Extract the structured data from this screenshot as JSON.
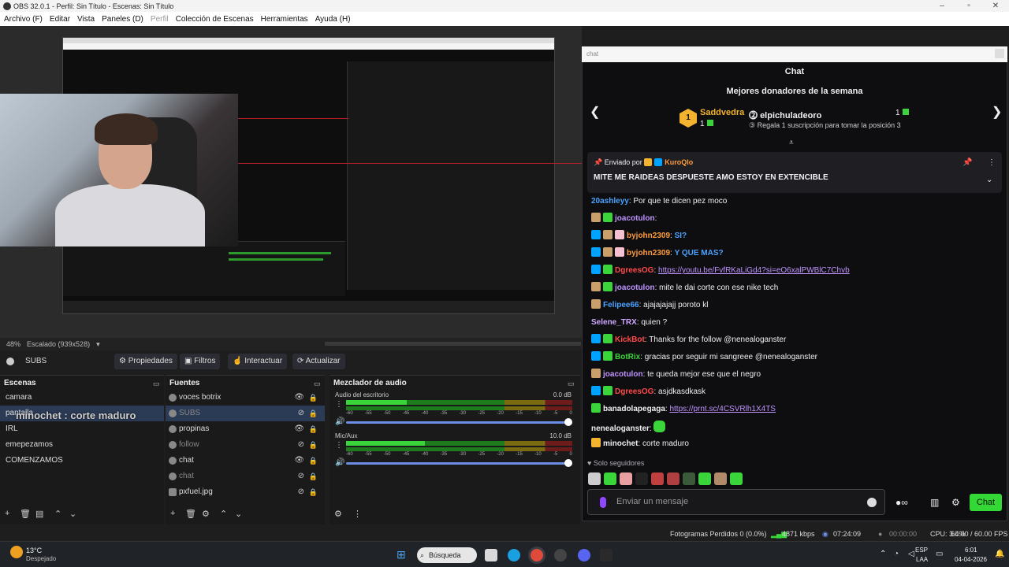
{
  "window": {
    "title": "OBS 32.0.1 - Perfil: Sin Título - Escenas: Sin Título"
  },
  "menu": [
    "Archivo (F)",
    "Editar",
    "Vista",
    "Paneles (D)",
    "Perfil",
    "Colección de Escenas",
    "Herramientas",
    "Ayuda (H)"
  ],
  "preview": {
    "zoom": "48%",
    "scale": "Escalado (939x528)"
  },
  "controls": {
    "source": "SUBS",
    "properties": "Propiedades",
    "filters": "Filtros",
    "interact": "Interactuar",
    "refresh": "Actualizar"
  },
  "scenes": {
    "title": "Escenas",
    "items": [
      "camara",
      "pantalla",
      "IRL",
      "emepezamos",
      "COMENZAMOS"
    ]
  },
  "overlay_text": "minochet : corte maduro",
  "sources": {
    "title": "Fuentes",
    "items": [
      "voces botrix",
      "SUBS",
      "propinas",
      "follow",
      "chat",
      "chat",
      "pxfuel.jpg"
    ]
  },
  "mixer": {
    "title": "Mezclador de audio",
    "channels": [
      {
        "name": "Audio del escritorio",
        "db": "0.0 dB",
        "level": 0.27
      },
      {
        "name": "Mic/Aux",
        "db": "10.0 dB",
        "level": 0.35
      }
    ],
    "ticks": [
      "-60",
      "-55",
      "-50",
      "-45",
      "-40",
      "-35",
      "-30",
      "-25",
      "-20",
      "-15",
      "-10",
      "-5",
      "0"
    ]
  },
  "status": {
    "dropped": "Fotogramas Perdidos 0 (0.0%)",
    "kbps": "4871 kbps",
    "live": "07:24:09",
    "rec": "00:00:00",
    "cpu": "CPU: 3.4%",
    "fps": "60.00 / 60.00 FPS"
  },
  "chat": {
    "bar": "chat",
    "title": "Chat",
    "donors_title": "Mejores donadores de la semana",
    "donor1": {
      "rank": "1",
      "name": "Saddvedra",
      "count": "1"
    },
    "donor2": {
      "name": "elpichuladeoro",
      "count": "1",
      "cta": "Regala 1 suscripción para tomar la posición 3"
    },
    "pinned": {
      "by": "Enviado por",
      "user": "KuroQlo",
      "text": "MITE ME RAIDEAS DESPUESTE AMO ESTOY EN EXTENCIBLE"
    },
    "messages": [
      {
        "user": "20ashleyy",
        "color": "#4aa3ff",
        "text": "Por que te dicen pez moco"
      },
      {
        "user": "joacotulon",
        "color": "#bf94ff",
        "text": ""
      },
      {
        "user": "byjohn2309",
        "color": "#ff9b3d",
        "text": "SI?"
      },
      {
        "user": "byjohn2309",
        "color": "#ff9b3d",
        "text": "Y QUE MAS?"
      },
      {
        "user": "DgreesOG",
        "color": "#ff4b4b",
        "text": "https://youtu.be/FvfRKaLiGd4?si=eO6xalPWBlC7Chvb"
      },
      {
        "user": "joacotulon",
        "color": "#bf94ff",
        "text": "mite le dai corte con ese nike tech"
      },
      {
        "user": "Felipee66",
        "color": "#4aa3ff",
        "text": "ajajajajajj poroto kl"
      },
      {
        "user": "Selene_TRX",
        "color": "#cfa8ff",
        "text": "quien ?"
      },
      {
        "user": "KickBot",
        "color": "#ff4b4b",
        "text": "Thanks for the follow @nenealoganster"
      },
      {
        "user": "BotRix",
        "color": "#3ad53a",
        "text": "gracias por seguir mi sangreee @nenealoganster"
      },
      {
        "user": "joacotulon",
        "color": "#bf94ff",
        "text": "te queda mejor ese que el negro"
      },
      {
        "user": "DgreesOG",
        "color": "#ff4b4b",
        "text": "asjdkasdkask"
      },
      {
        "user": "banadolapegaga",
        "color": "#efeff1",
        "text": "https://prnt.sc/4CSVRlh1X4TS"
      },
      {
        "user": "nenealoganster",
        "color": "#efeff1",
        "text": ""
      },
      {
        "user": "minochet",
        "color": "#efeff1",
        "text": "corte maduro"
      }
    ],
    "followers_only": "Solo seguidores",
    "input_placeholder": "Enviar un mensaje",
    "send": "Chat"
  },
  "taskbar": {
    "weather_temp": "13°C",
    "weather_desc": "Despejado",
    "search": "Búsqueda",
    "lang": "ESP",
    "lang2": "LAA",
    "time": "6:01",
    "date": "04-04-2026"
  }
}
